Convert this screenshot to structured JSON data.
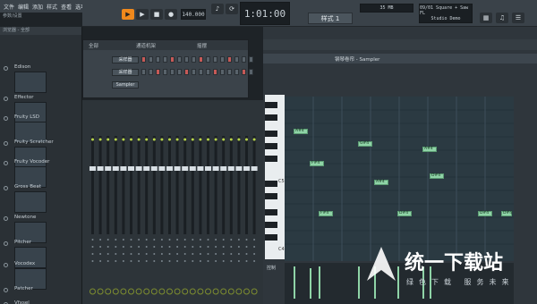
{
  "menu": [
    "文件",
    "编辑",
    "添加",
    "样式",
    "查看",
    "选项",
    "工具",
    "帮助"
  ],
  "hint": "参数/设置",
  "transport": {
    "time": "1:01:00",
    "tempo": "140.000",
    "pattern_label": "样式 1",
    "cpu": "35 MB",
    "song_info_title": "09/01 Square + Saw FL",
    "song_info_sub": "Studio Demo"
  },
  "browser": {
    "header": "浏览器 - 全部",
    "plugins": [
      {
        "name": "Edison"
      },
      {
        "name": "Effector"
      },
      {
        "name": "Fruity LSD"
      },
      {
        "name": "Fruity Scratcher"
      },
      {
        "name": "Fruity Vocoder"
      },
      {
        "name": "Gross Beat"
      },
      {
        "name": "Newtone"
      },
      {
        "name": "Pitcher"
      },
      {
        "name": "Vocodex"
      },
      {
        "name": "Patcher"
      },
      {
        "name": "Vfxsel"
      },
      {
        "name": "(none)"
      }
    ]
  },
  "channel_rack": {
    "title": "通道机架",
    "filter": "全部",
    "swing_label": "摇摆",
    "channels": [
      {
        "name": "采样器",
        "steps": [
          1,
          0,
          0,
          0,
          1,
          0,
          0,
          0,
          1,
          0,
          0,
          0,
          1,
          0,
          0,
          0
        ]
      },
      {
        "name": "采样器",
        "steps": [
          0,
          0,
          1,
          0,
          0,
          0,
          1,
          0,
          0,
          0,
          1,
          0,
          0,
          0,
          1,
          0
        ]
      },
      {
        "name": "Sampler",
        "steps": [
          0,
          0,
          0,
          0,
          0,
          0,
          0,
          0,
          0,
          0,
          0,
          0,
          0,
          0,
          0,
          0
        ]
      }
    ]
  },
  "piano_roll": {
    "title": "钢琴卷帘 - Sampler",
    "octave_label": "C5",
    "octave_label2": "C4",
    "control_label": "控制",
    "notes": [
      {
        "label": "A#4"
      },
      {
        "label": "G#4"
      },
      {
        "label": "A#4"
      },
      {
        "label": "F#4"
      },
      {
        "label": "A#4"
      },
      {
        "label": "D#4"
      },
      {
        "label": "F#4"
      },
      {
        "label": "D#4"
      },
      {
        "label": "D#4"
      },
      {
        "label": "D#4"
      }
    ]
  },
  "watermark": {
    "text": "统一下载站",
    "sub": "绿色下载 服务未来"
  },
  "colors": {
    "accent_orange": "#f0891c",
    "note_green": "#8fd4a7",
    "step_red": "#c65a57"
  }
}
